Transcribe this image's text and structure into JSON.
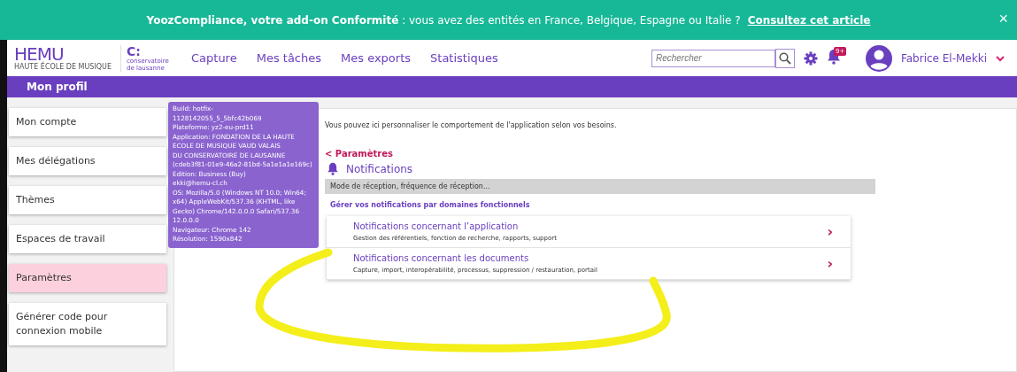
{
  "banner": {
    "text": "**YoozCompliance, votre add-on Conformité** : vous avez des entités en France, Belgique, Espagne ou Italie ?",
    "link": "Consultez cet article",
    "close": "×"
  },
  "header": {
    "logo_main": "HEMU",
    "logo_sub": "HAUTE ÉCOLE DE MUSIQUE",
    "logo2_mark": "C:",
    "logo2_text": "conservatoire de lausanne",
    "nav": [
      {
        "label": "Capture",
        "selected": false
      },
      {
        "label": "Mes tâches",
        "selected": false
      },
      {
        "label": "Mes exports",
        "selected": false
      },
      {
        "label": "Statistiques",
        "selected": false
      }
    ],
    "search": {
      "placeholder": "Rechercher"
    },
    "badge": "9+",
    "user": "Fabrice El-Mekki"
  },
  "profile_bar": {
    "title": "Mon profil"
  },
  "tooltip": {
    "lines": [
      "Build: hotfix-",
      "1128142055_5_5bfc42b069",
      "Plateforme: yz2-eu-prd11",
      "Application: FONDATION DE LA HAUTE ECOLE DE MUSIQUE VAUD VALAIS",
      "DU CONSERVATOIRE DE LAUSANNE (cdeb3f81-01e9-46a2-81bd-5a1e1a1e169c)",
      "Edition: Business (Buy)",
      "ekki@hemu-cl.ch",
      "OS: Mozilla/5.0 (Windows NT 10.0; Win64; x64) AppleWebKit/537.36 (KHTML, like Gecko) Chrome/142.0.0.0 Safari/537.36",
      "12.0.0.0",
      "Navigateur: Chrome 142",
      "Résolution: 1590x842"
    ]
  },
  "sidebar": {
    "items": [
      {
        "label": "Mon compte",
        "selected": false
      },
      {
        "label": "Mes délégations",
        "selected": false
      },
      {
        "label": "Thèmes",
        "selected": false
      },
      {
        "label": "Espaces de travail",
        "selected": false
      },
      {
        "label": "Paramètres",
        "selected": true
      },
      {
        "label": "Générer code pour connexion mobile",
        "selected": false
      }
    ]
  },
  "main": {
    "intro": "Vous pouvez ici personnaliser le comportement de l'application selon vos besoins.",
    "back_link": "< Paramètres",
    "title": "Notifications",
    "section_bar": "Mode de réception, fréquence de réception...",
    "subheading": "Gérer vos notifications par domaines fonctionnels",
    "cards": [
      {
        "title": "Notifications concernant l’application",
        "description": "Gestion des référentiels, fonction de recherche, rapports, support",
        "chevron": "›"
      },
      {
        "title": "Notifications concernant les documents",
        "description": "Capture, import, interopérabilité, processus, suppression / restauration, portail",
        "chevron": "›"
      }
    ]
  }
}
